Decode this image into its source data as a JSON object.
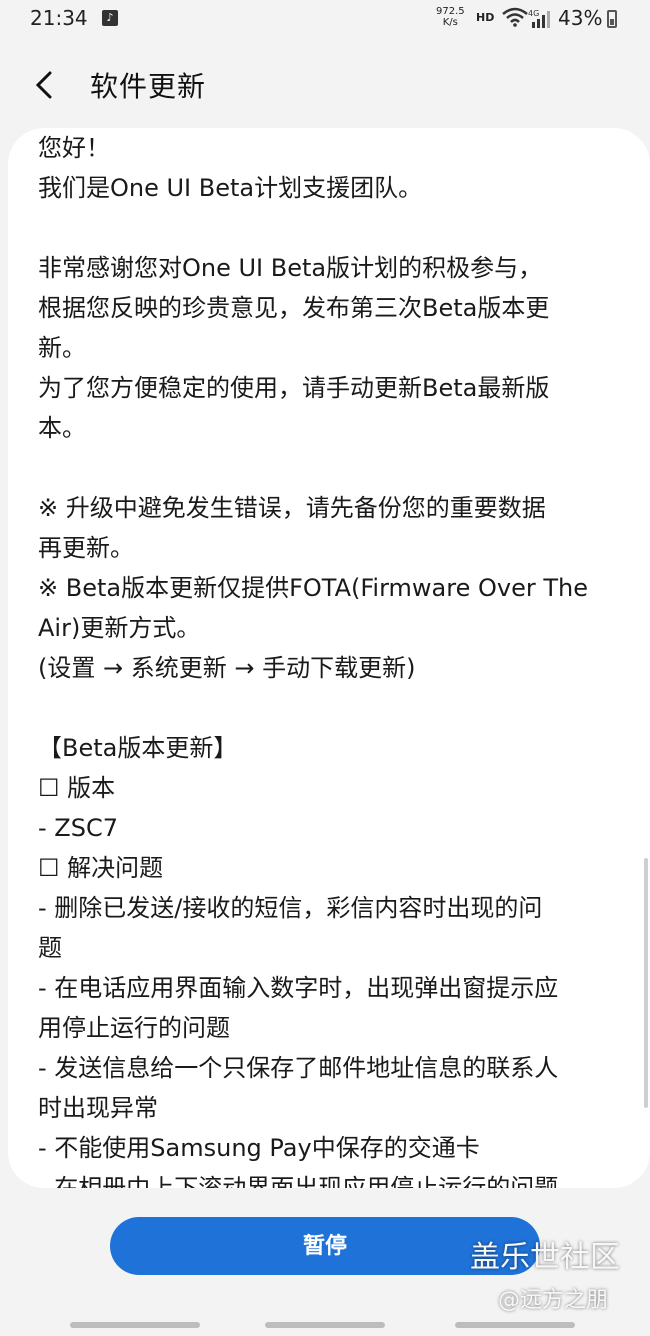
{
  "status_bar": {
    "time": "21:34",
    "net_speed_value": "972.5",
    "net_speed_unit": "K/s",
    "hd_label": "HD",
    "network_type": "4G",
    "battery_percent": "43%"
  },
  "header": {
    "title": "软件更新"
  },
  "content": {
    "text": "您好！\n我们是One UI Beta计划支援团队。\n\n非常感谢您对One UI Beta版计划的积极参与，\n根据您反映的珍贵意见，发布第三次Beta版本更\n新。\n为了您方便稳定的使用，请手动更新Beta最新版\n本。\n\n※ 升级中避免发生错误，请先备份您的重要数据\n再更新。\n※ Beta版本更新仅提供FOTA(Firmware Over The\nAir)更新方式。\n(设置 → 系统更新 → 手动下载更新)\n\n【Beta版本更新】\n☐ 版本\n- ZSC7\n☐ 解决问题\n- 删除已发送/接收的短信，彩信内容时出现的问\n题\n- 在电话应用界面输入数字时，出现弹出窗提示应\n用停止运行的问题\n- 发送信息给一个只保存了邮件地址信息的联系人\n时出现异常\n- 不能使用Samsung Pay中保存的交通卡\n- 在相册中上下滚动界面出现应用停止运行的问题"
  },
  "footer": {
    "pause_button_label": "暂停"
  },
  "watermark": {
    "site": "盖乐世社区",
    "handle": "@远方之朋"
  },
  "colors": {
    "accent": "#1e72d8",
    "background": "#f3f3f3",
    "card": "#ffffff"
  }
}
